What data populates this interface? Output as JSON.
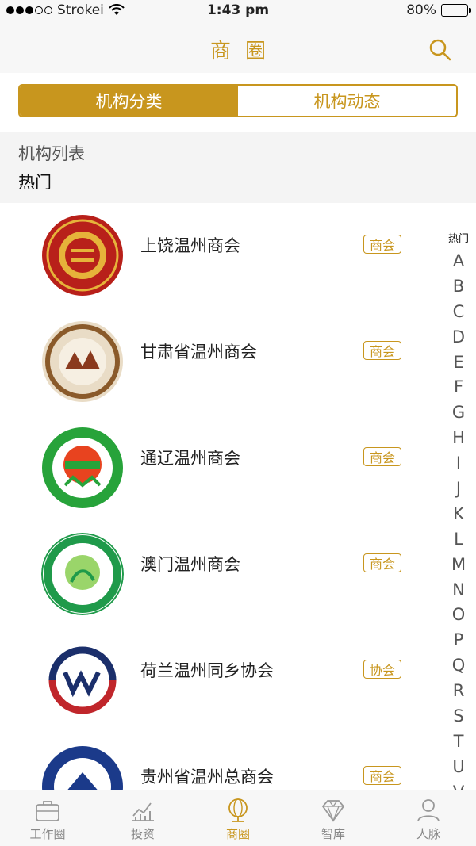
{
  "status_bar": {
    "carrier": "Strokei",
    "time": "1:43 pm",
    "battery": "80%",
    "battery_level": 0.8
  },
  "nav": {
    "title": "商圈",
    "search_icon": "search-icon"
  },
  "segments": [
    {
      "label": "机构分类",
      "active": true
    },
    {
      "label": "机构动态",
      "active": false
    }
  ],
  "section": {
    "title": "机构列表",
    "subtitle": "热门"
  },
  "organizations": [
    {
      "name": "上饶温州商会",
      "tag": "商会",
      "logo": "shangrao-logo"
    },
    {
      "name": "甘肃省温州商会",
      "tag": "商会",
      "logo": "gansu-logo"
    },
    {
      "name": "通辽温州商会",
      "tag": "商会",
      "logo": "tongliao-logo"
    },
    {
      "name": "澳门温州商会",
      "tag": "商会",
      "logo": "macau-logo"
    },
    {
      "name": "荷兰温州同乡协会",
      "tag": "协会",
      "logo": "netherlands-logo"
    },
    {
      "name": "贵州省温州总商会",
      "tag": "商会",
      "logo": "guizhou-logo"
    }
  ],
  "index_bar": [
    "热门",
    "A",
    "B",
    "C",
    "D",
    "E",
    "F",
    "G",
    "H",
    "I",
    "J",
    "K",
    "L",
    "M",
    "N",
    "O",
    "P",
    "Q",
    "R",
    "S",
    "T",
    "U",
    "V"
  ],
  "tabs": [
    {
      "label": "工作圈",
      "icon": "briefcase-icon",
      "active": false
    },
    {
      "label": "投资",
      "icon": "chart-icon",
      "active": false
    },
    {
      "label": "商圈",
      "icon": "globe-icon",
      "active": true
    },
    {
      "label": "智库",
      "icon": "diamond-icon",
      "active": false
    },
    {
      "label": "人脉",
      "icon": "person-icon",
      "active": false
    }
  ],
  "colors": {
    "accent": "#c8961e",
    "text": "#222222",
    "muted": "#888888"
  }
}
